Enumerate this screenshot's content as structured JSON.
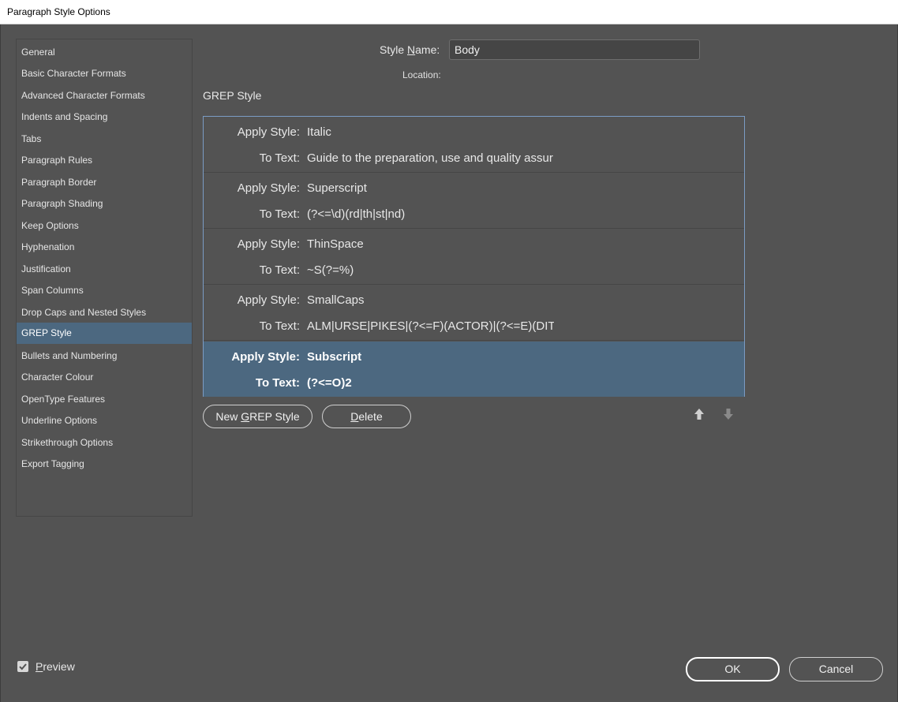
{
  "window": {
    "title": "Paragraph Style Options"
  },
  "categories": [
    {
      "label": "General"
    },
    {
      "label": "Basic Character Formats"
    },
    {
      "label": "Advanced Character Formats"
    },
    {
      "label": "Indents and Spacing"
    },
    {
      "label": "Tabs"
    },
    {
      "label": "Paragraph Rules"
    },
    {
      "label": "Paragraph Border"
    },
    {
      "label": "Paragraph Shading"
    },
    {
      "label": "Keep Options"
    },
    {
      "label": "Hyphenation"
    },
    {
      "label": "Justification"
    },
    {
      "label": "Span Columns"
    },
    {
      "label": "Drop Caps and Nested Styles"
    },
    {
      "label": "GREP Style",
      "selected": true
    },
    {
      "label": "Bullets and Numbering"
    },
    {
      "label": "Character Colour"
    },
    {
      "label": "OpenType Features"
    },
    {
      "label": "Underline Options"
    },
    {
      "label": "Strikethrough Options"
    },
    {
      "label": "Export Tagging"
    }
  ],
  "header": {
    "style_name_label_pre": "Style ",
    "style_name_label_ul": "N",
    "style_name_label_post": "ame:",
    "style_name_value": "Body",
    "location_label": "Location:"
  },
  "section": {
    "title": "GREP Style"
  },
  "grep_rules": {
    "apply_label": "Apply Style:",
    "to_text_label": "To Text:",
    "items": [
      {
        "style": "Italic",
        "text": "Guide to the preparation, use and quality assur"
      },
      {
        "style": "Superscript",
        "text": "(?<=\\d)(rd|th|st|nd)"
      },
      {
        "style": "ThinSpace",
        "text": "~S(?=%)"
      },
      {
        "style": "SmallCaps",
        "text": "ALM|URSE|PIKES|(?<=F)(ACTOR)|(?<=E)(DIT"
      },
      {
        "style": "Subscript",
        "text": "(?<=O)2",
        "selected": true
      }
    ]
  },
  "buttons": {
    "new_grep_pre": "New ",
    "new_grep_ul": "G",
    "new_grep_post": "REP Style",
    "delete_ul": "D",
    "delete_post": "elete",
    "ok": "OK",
    "cancel": "Cancel"
  },
  "preview": {
    "label_ul": "P",
    "label_post": "review",
    "checked": true
  },
  "colors": {
    "background": "#535353",
    "selection": "#4c6880",
    "list_border": "#7b9cc4"
  }
}
